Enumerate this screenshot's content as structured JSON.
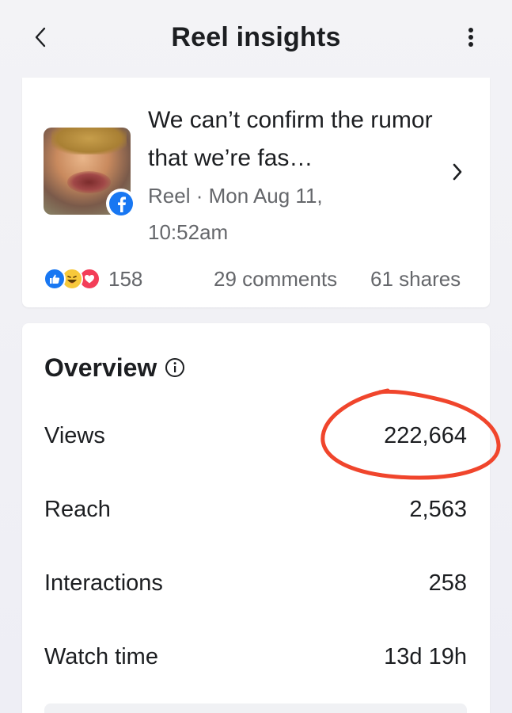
{
  "header": {
    "title": "Reel insights",
    "back_icon": "chevron-left-icon",
    "more_icon": "more-vertical-icon"
  },
  "post": {
    "title": "We can’t confirm the rumor that we’re fas…",
    "meta": "Reel · Mon Aug 11, 10:52am",
    "platform_badge": "facebook-icon",
    "reactions": {
      "icons": [
        "like-icon",
        "haha-icon",
        "love-icon"
      ],
      "count": "158"
    },
    "comments": "29 comments",
    "shares": "61 shares"
  },
  "overview": {
    "title": "Overview",
    "metrics": [
      {
        "label": "Views",
        "value": "222,664"
      },
      {
        "label": "Reach",
        "value": "2,563"
      },
      {
        "label": "Interactions",
        "value": "258"
      },
      {
        "label": "Watch time",
        "value": "13d 19h"
      }
    ]
  },
  "colors": {
    "facebook_blue": "#1877f2",
    "secondary_text": "#65676b",
    "annotation_red": "#f0452c"
  }
}
